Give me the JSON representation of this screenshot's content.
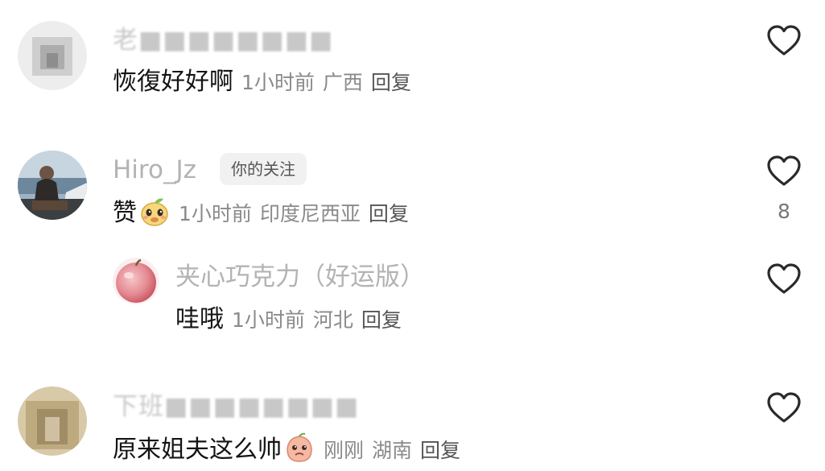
{
  "comments": [
    {
      "username": "老■■■■■■■■",
      "text": "恢復好好啊",
      "time": "1小时前",
      "location": "广西",
      "reply_label": "回复",
      "like_count": ""
    },
    {
      "username": "Hiro_Jz",
      "badge": "你的关注",
      "text": "赞",
      "time": "1小时前",
      "location": "印度尼西亚",
      "reply_label": "回复",
      "like_count": "8",
      "replies": [
        {
          "username": "夹心巧克力（好运版）",
          "text": "哇哦",
          "time": "1小时前",
          "location": "河北",
          "reply_label": "回复",
          "like_count": ""
        }
      ]
    },
    {
      "username": "下班■■■■■■■■",
      "text": "原来姐夫这么帅",
      "time": "刚刚",
      "location": "湖南",
      "reply_label": "回复",
      "like_count": ""
    }
  ],
  "icons": {
    "like": "heart-outline-icon",
    "emoji_face": "sprout-face-emoji",
    "emoji_peach": "peach-face-emoji"
  },
  "colors": {
    "text_primary": "#141414",
    "text_meta": "#8a8a8a",
    "username": "#b3b3b3"
  }
}
